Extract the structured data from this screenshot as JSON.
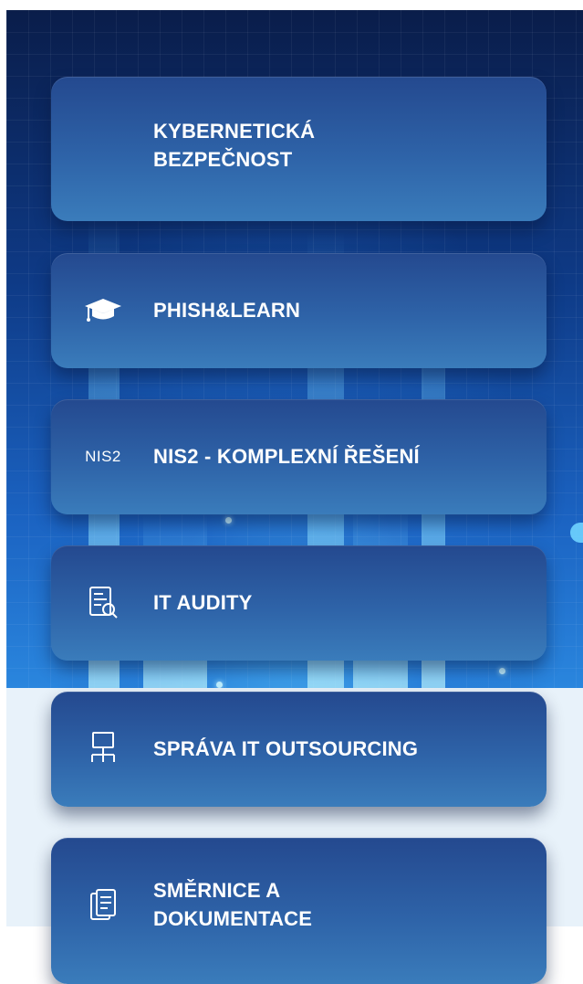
{
  "menu": {
    "items": [
      {
        "label_line1": "KYBERNETICKÁ",
        "label_line2": "BEZPEČNOST",
        "icon": "none"
      },
      {
        "label": "PHISH&LEARN",
        "icon": "graduation-cap-icon"
      },
      {
        "label": "NIS2 - KOMPLEXNÍ ŘEŠENÍ",
        "icon_text": "NIS2",
        "icon": "nis2-text-icon"
      },
      {
        "label": "IT AUDITY",
        "icon": "audit-report-icon"
      },
      {
        "label": "SPRÁVA IT OUTSOURCING",
        "icon": "network-monitor-icon"
      },
      {
        "label_line1": "SMĚRNICE A",
        "label_line2": "DOKUMENTACE",
        "icon": "documents-icon"
      }
    ]
  },
  "colors": {
    "card_top": "#24498f",
    "card_bottom": "#3a7cbb",
    "hero_dark": "#0a1d4a",
    "hero_light": "#2a86de",
    "lower_bg": "#e8f2fa",
    "text": "#ffffff"
  }
}
